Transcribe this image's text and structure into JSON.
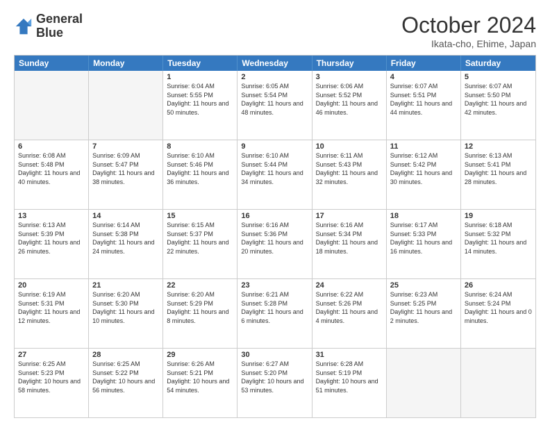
{
  "header": {
    "logo_line1": "General",
    "logo_line2": "Blue",
    "month": "October 2024",
    "location": "Ikata-cho, Ehime, Japan"
  },
  "days_of_week": [
    "Sunday",
    "Monday",
    "Tuesday",
    "Wednesday",
    "Thursday",
    "Friday",
    "Saturday"
  ],
  "weeks": [
    [
      {
        "day": "",
        "empty": true
      },
      {
        "day": "",
        "empty": true
      },
      {
        "day": "1",
        "sunrise": "Sunrise: 6:04 AM",
        "sunset": "Sunset: 5:55 PM",
        "daylight": "Daylight: 11 hours and 50 minutes."
      },
      {
        "day": "2",
        "sunrise": "Sunrise: 6:05 AM",
        "sunset": "Sunset: 5:54 PM",
        "daylight": "Daylight: 11 hours and 48 minutes."
      },
      {
        "day": "3",
        "sunrise": "Sunrise: 6:06 AM",
        "sunset": "Sunset: 5:52 PM",
        "daylight": "Daylight: 11 hours and 46 minutes."
      },
      {
        "day": "4",
        "sunrise": "Sunrise: 6:07 AM",
        "sunset": "Sunset: 5:51 PM",
        "daylight": "Daylight: 11 hours and 44 minutes."
      },
      {
        "day": "5",
        "sunrise": "Sunrise: 6:07 AM",
        "sunset": "Sunset: 5:50 PM",
        "daylight": "Daylight: 11 hours and 42 minutes."
      }
    ],
    [
      {
        "day": "6",
        "sunrise": "Sunrise: 6:08 AM",
        "sunset": "Sunset: 5:48 PM",
        "daylight": "Daylight: 11 hours and 40 minutes."
      },
      {
        "day": "7",
        "sunrise": "Sunrise: 6:09 AM",
        "sunset": "Sunset: 5:47 PM",
        "daylight": "Daylight: 11 hours and 38 minutes."
      },
      {
        "day": "8",
        "sunrise": "Sunrise: 6:10 AM",
        "sunset": "Sunset: 5:46 PM",
        "daylight": "Daylight: 11 hours and 36 minutes."
      },
      {
        "day": "9",
        "sunrise": "Sunrise: 6:10 AM",
        "sunset": "Sunset: 5:44 PM",
        "daylight": "Daylight: 11 hours and 34 minutes."
      },
      {
        "day": "10",
        "sunrise": "Sunrise: 6:11 AM",
        "sunset": "Sunset: 5:43 PM",
        "daylight": "Daylight: 11 hours and 32 minutes."
      },
      {
        "day": "11",
        "sunrise": "Sunrise: 6:12 AM",
        "sunset": "Sunset: 5:42 PM",
        "daylight": "Daylight: 11 hours and 30 minutes."
      },
      {
        "day": "12",
        "sunrise": "Sunrise: 6:13 AM",
        "sunset": "Sunset: 5:41 PM",
        "daylight": "Daylight: 11 hours and 28 minutes."
      }
    ],
    [
      {
        "day": "13",
        "sunrise": "Sunrise: 6:13 AM",
        "sunset": "Sunset: 5:39 PM",
        "daylight": "Daylight: 11 hours and 26 minutes."
      },
      {
        "day": "14",
        "sunrise": "Sunrise: 6:14 AM",
        "sunset": "Sunset: 5:38 PM",
        "daylight": "Daylight: 11 hours and 24 minutes."
      },
      {
        "day": "15",
        "sunrise": "Sunrise: 6:15 AM",
        "sunset": "Sunset: 5:37 PM",
        "daylight": "Daylight: 11 hours and 22 minutes."
      },
      {
        "day": "16",
        "sunrise": "Sunrise: 6:16 AM",
        "sunset": "Sunset: 5:36 PM",
        "daylight": "Daylight: 11 hours and 20 minutes."
      },
      {
        "day": "17",
        "sunrise": "Sunrise: 6:16 AM",
        "sunset": "Sunset: 5:34 PM",
        "daylight": "Daylight: 11 hours and 18 minutes."
      },
      {
        "day": "18",
        "sunrise": "Sunrise: 6:17 AM",
        "sunset": "Sunset: 5:33 PM",
        "daylight": "Daylight: 11 hours and 16 minutes."
      },
      {
        "day": "19",
        "sunrise": "Sunrise: 6:18 AM",
        "sunset": "Sunset: 5:32 PM",
        "daylight": "Daylight: 11 hours and 14 minutes."
      }
    ],
    [
      {
        "day": "20",
        "sunrise": "Sunrise: 6:19 AM",
        "sunset": "Sunset: 5:31 PM",
        "daylight": "Daylight: 11 hours and 12 minutes."
      },
      {
        "day": "21",
        "sunrise": "Sunrise: 6:20 AM",
        "sunset": "Sunset: 5:30 PM",
        "daylight": "Daylight: 11 hours and 10 minutes."
      },
      {
        "day": "22",
        "sunrise": "Sunrise: 6:20 AM",
        "sunset": "Sunset: 5:29 PM",
        "daylight": "Daylight: 11 hours and 8 minutes."
      },
      {
        "day": "23",
        "sunrise": "Sunrise: 6:21 AM",
        "sunset": "Sunset: 5:28 PM",
        "daylight": "Daylight: 11 hours and 6 minutes."
      },
      {
        "day": "24",
        "sunrise": "Sunrise: 6:22 AM",
        "sunset": "Sunset: 5:26 PM",
        "daylight": "Daylight: 11 hours and 4 minutes."
      },
      {
        "day": "25",
        "sunrise": "Sunrise: 6:23 AM",
        "sunset": "Sunset: 5:25 PM",
        "daylight": "Daylight: 11 hours and 2 minutes."
      },
      {
        "day": "26",
        "sunrise": "Sunrise: 6:24 AM",
        "sunset": "Sunset: 5:24 PM",
        "daylight": "Daylight: 11 hours and 0 minutes."
      }
    ],
    [
      {
        "day": "27",
        "sunrise": "Sunrise: 6:25 AM",
        "sunset": "Sunset: 5:23 PM",
        "daylight": "Daylight: 10 hours and 58 minutes."
      },
      {
        "day": "28",
        "sunrise": "Sunrise: 6:25 AM",
        "sunset": "Sunset: 5:22 PM",
        "daylight": "Daylight: 10 hours and 56 minutes."
      },
      {
        "day": "29",
        "sunrise": "Sunrise: 6:26 AM",
        "sunset": "Sunset: 5:21 PM",
        "daylight": "Daylight: 10 hours and 54 minutes."
      },
      {
        "day": "30",
        "sunrise": "Sunrise: 6:27 AM",
        "sunset": "Sunset: 5:20 PM",
        "daylight": "Daylight: 10 hours and 53 minutes."
      },
      {
        "day": "31",
        "sunrise": "Sunrise: 6:28 AM",
        "sunset": "Sunset: 5:19 PM",
        "daylight": "Daylight: 10 hours and 51 minutes."
      },
      {
        "day": "",
        "empty": true
      },
      {
        "day": "",
        "empty": true
      }
    ]
  ]
}
